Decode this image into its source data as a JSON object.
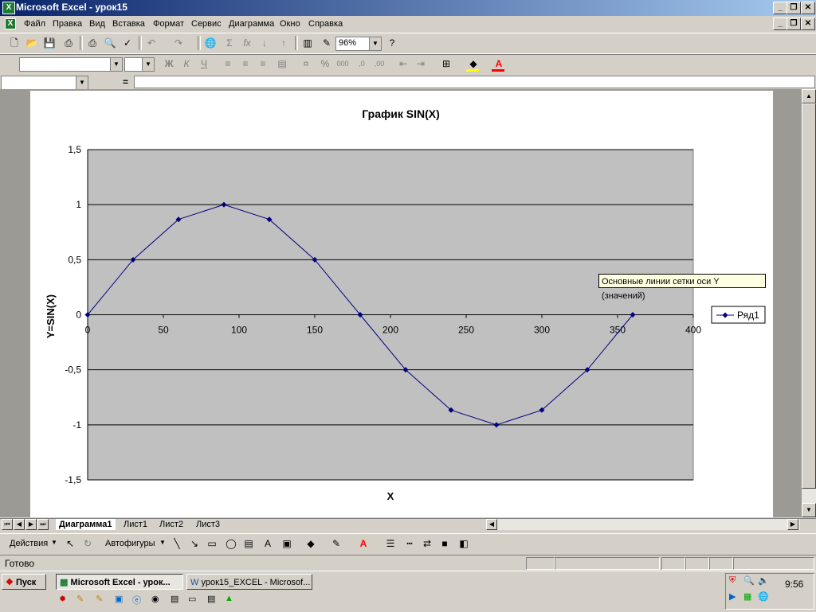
{
  "window": {
    "title": "Microsoft Excel - урок15",
    "app_icon": "excel-icon"
  },
  "menu": {
    "items": [
      "Файл",
      "Правка",
      "Вид",
      "Вставка",
      "Формат",
      "Сервис",
      "Диаграмма",
      "Окно",
      "Справка"
    ]
  },
  "toolbar": {
    "zoom": "96%"
  },
  "formula_bar": {
    "equals": "="
  },
  "chart": {
    "tooltip": "Основные линии сетки оси Y (значений)"
  },
  "chart_data": {
    "type": "line",
    "title": "График SIN(X)",
    "xlabel": "X",
    "ylabel": "Y=SIN(X)",
    "xlim": [
      0,
      400
    ],
    "ylim": [
      -1.5,
      1.5
    ],
    "x_ticks": [
      "0",
      "50",
      "100",
      "150",
      "200",
      "250",
      "300",
      "350",
      "400"
    ],
    "y_ticks": [
      "1,5",
      "1",
      "0,5",
      "0",
      "-0,5",
      "-1",
      "-1,5"
    ],
    "grid": "horizontal major gridlines",
    "legend": "right",
    "plot_bg": "#c0c0c0",
    "series": [
      {
        "name": "Ряд1",
        "color": "#000080",
        "marker": "diamond",
        "x": [
          0,
          30,
          60,
          90,
          120,
          150,
          180,
          210,
          240,
          270,
          300,
          330,
          360
        ],
        "y": [
          0,
          0.5,
          0.866,
          1,
          0.866,
          0.5,
          0,
          -0.5,
          -0.866,
          -1,
          -0.866,
          -0.5,
          0
        ]
      }
    ]
  },
  "sheet_tabs": [
    "Диаграмма1",
    "Лист1",
    "Лист2",
    "Лист3"
  ],
  "active_tab": "Диаграмма1",
  "drawing": {
    "actions": "Действия",
    "autoshapes": "Автофигуры"
  },
  "status": {
    "text": "Готово"
  },
  "taskbar": {
    "start": "Пуск",
    "tasks": [
      "Microsoft Excel - урок...",
      "урок15_EXCEL - Microsof..."
    ],
    "clock": "9:56"
  }
}
